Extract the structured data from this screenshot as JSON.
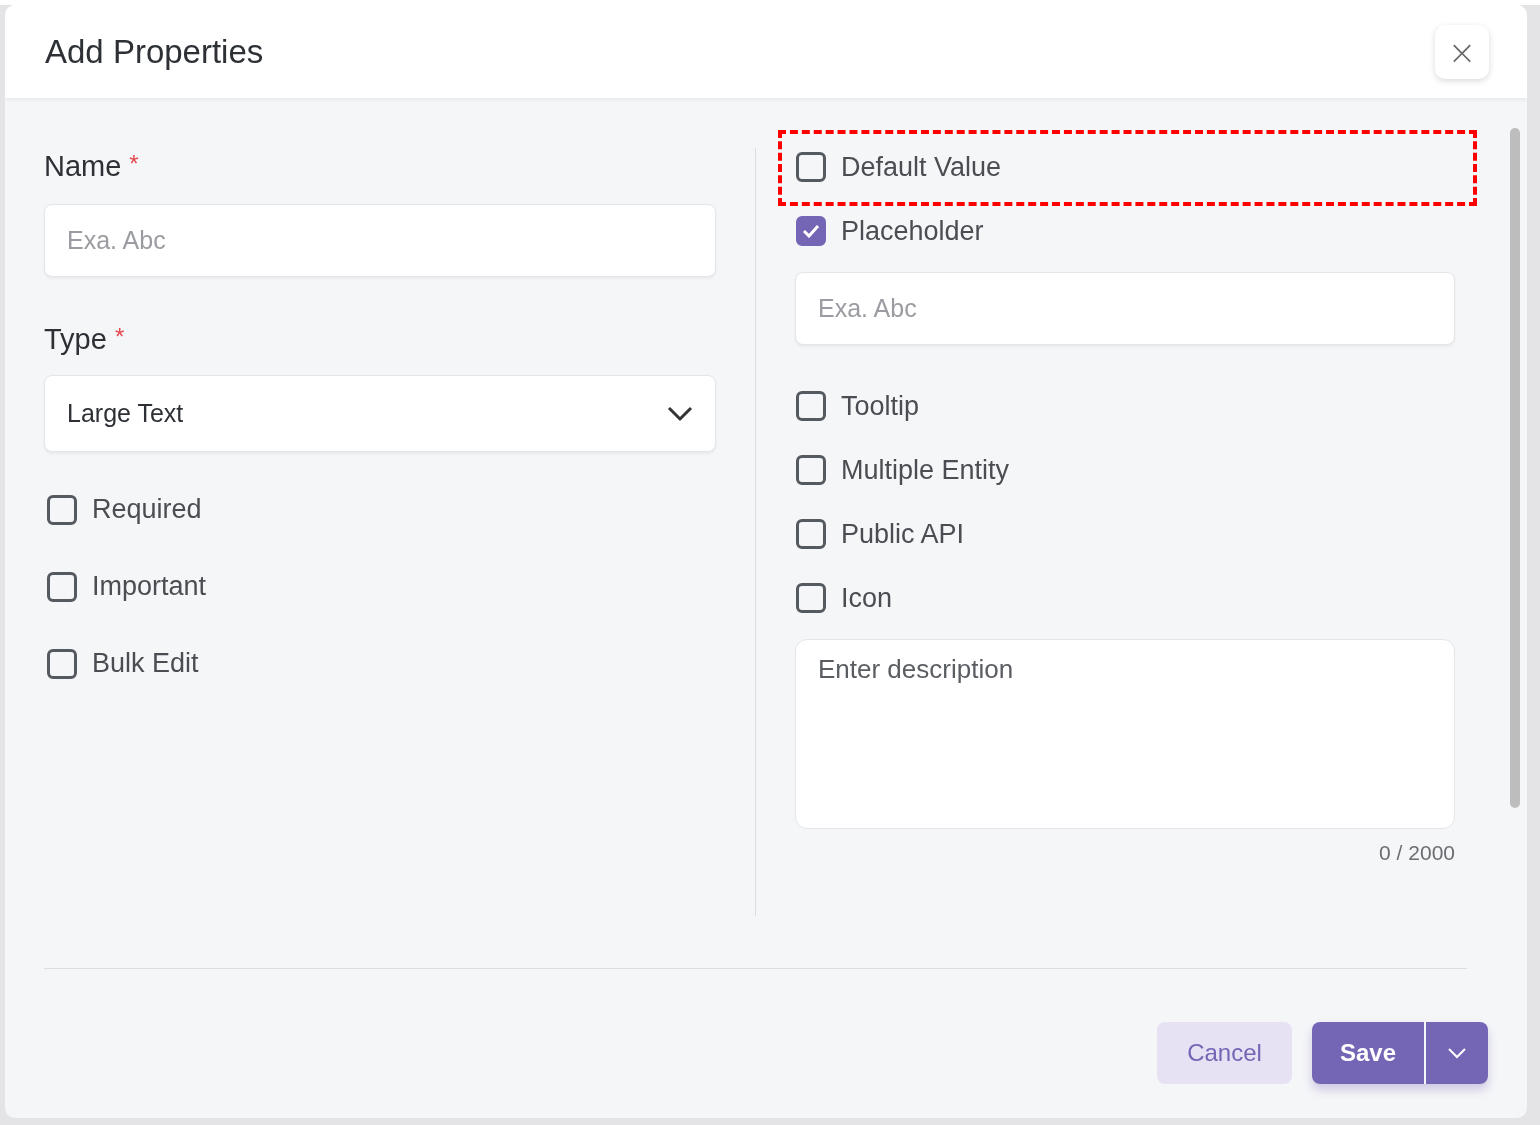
{
  "dialog": {
    "title": "Add Properties",
    "close_icon": "×"
  },
  "left": {
    "fields": [
      {
        "kind": "input",
        "label": "Name",
        "required_mark": "*",
        "placeholder": "Exa. Abc"
      },
      {
        "kind": "select",
        "label": "Type",
        "required_mark": "*",
        "value": "Large Text"
      }
    ],
    "options": [
      {
        "label": "Required",
        "checked": false
      },
      {
        "label": "Important",
        "checked": false
      },
      {
        "label": "Bulk Edit",
        "checked": false
      }
    ]
  },
  "right": {
    "items": [
      {
        "kind": "checkbox",
        "label": "Default Value",
        "checked": false,
        "highlighted": true
      },
      {
        "kind": "checkbox",
        "label": "Placeholder",
        "checked": true,
        "highlighted": false
      },
      {
        "kind": "field",
        "placeholder": "Exa. Abc"
      },
      {
        "kind": "checkbox",
        "label": "Tooltip",
        "checked": false,
        "highlighted": false
      },
      {
        "kind": "checkbox",
        "label": "Multiple Entity",
        "checked": false,
        "highlighted": false
      },
      {
        "kind": "checkbox",
        "label": "Public API",
        "checked": false,
        "highlighted": false
      },
      {
        "kind": "checkbox",
        "label": "Icon",
        "checked": false,
        "highlighted": false
      }
    ],
    "description": {
      "placeholder": "Enter description",
      "counter": "0 / 2000"
    }
  },
  "footer": {
    "buttons": [
      {
        "kind": "secondary",
        "label": "Cancel"
      },
      {
        "kind": "primary",
        "label": "Save"
      },
      {
        "kind": "dropdown"
      }
    ]
  }
}
